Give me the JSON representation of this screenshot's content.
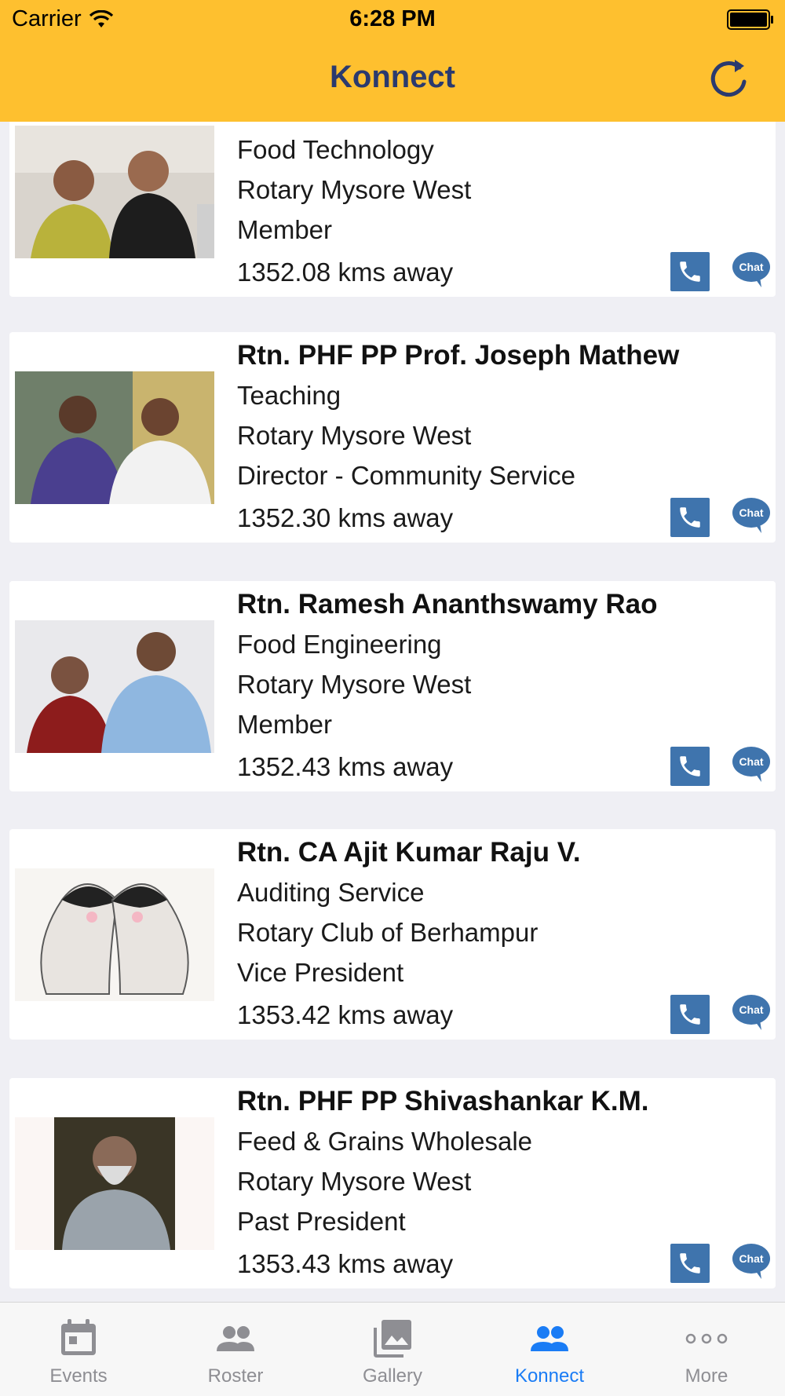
{
  "status_bar": {
    "carrier": "Carrier",
    "time": "6:28 PM"
  },
  "nav": {
    "title": "Konnect",
    "refresh_icon": "refresh-icon"
  },
  "members": [
    {
      "name": "",
      "profession": "Food Technology",
      "club": "Rotary Mysore West",
      "role": "Member",
      "distance": "1352.08 kms away"
    },
    {
      "name": "Rtn. PHF PP Prof.  Joseph Mathew",
      "profession": "Teaching",
      "club": "Rotary Mysore West",
      "role": "Director - Community Service",
      "distance": "1352.30 kms away"
    },
    {
      "name": "Rtn. Ramesh Ananthswamy Rao",
      "profession": "Food Engineering",
      "club": "Rotary Mysore West",
      "role": "Member",
      "distance": "1352.43 kms away"
    },
    {
      "name": "Rtn. CA  Ajit Kumar Raju V.",
      "profession": "Auditing Service",
      "club": "Rotary Club of Berhampur",
      "role": "Vice President",
      "distance": "1353.42 kms away"
    },
    {
      "name": "Rtn. PHF PP Shivashankar K.M.",
      "profession": "Feed & Grains Wholesale",
      "club": "Rotary Mysore West",
      "role": "Past President",
      "distance": "1353.43 kms away"
    }
  ],
  "chat_label": "Chat",
  "tabs": [
    {
      "label": "Events",
      "icon": "calendar-icon",
      "active": false
    },
    {
      "label": "Roster",
      "icon": "people-icon",
      "active": false
    },
    {
      "label": "Gallery",
      "icon": "gallery-icon",
      "active": false
    },
    {
      "label": "Konnect",
      "icon": "people-icon",
      "active": true
    },
    {
      "label": "More",
      "icon": "more-icon",
      "active": false
    }
  ],
  "colors": {
    "header": "#fec02f",
    "title": "#2b3a6e",
    "call_button": "#3f74ad",
    "active_tab": "#1a7cf5",
    "inactive_tab": "#8e8e93"
  }
}
